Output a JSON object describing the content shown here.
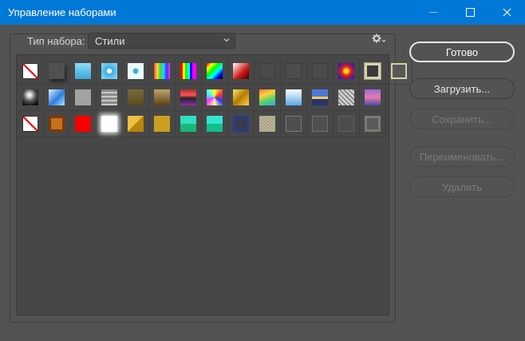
{
  "window": {
    "title": "Управление наборами"
  },
  "set_type": {
    "label": "Тип набора:",
    "value": "Стили"
  },
  "buttons": {
    "done": "Готово",
    "load": "Загрузить...",
    "save": "Сохранить...",
    "rename": "Переименовать...",
    "delete": "Удалить"
  },
  "icons": {
    "gear": "gear-icon",
    "dropdown": "chevron-down-icon",
    "minimize": "minimize-icon",
    "maximize": "maximize-icon",
    "close": "close-icon"
  },
  "colors": {
    "titlebar": "#0078d7",
    "panel": "#535353"
  },
  "styles_grid": {
    "rows": [
      [
        "none",
        "drop-shadow-gray",
        "blue-gradient",
        "blue-dot",
        "blue-dot-light",
        "rainbow-vertical",
        "rainbow-bars",
        "spectrum",
        "red-fade",
        "dark-square",
        "dark-square-2",
        "dark-square-3",
        "purple-orange",
        "yellow-radial",
        "beige-frame"
      ],
      [
        "chrome-ball",
        "blue-glass",
        "gray-flat",
        "metal-text",
        "olive-brown",
        "brown-gradient",
        "red-stripes",
        "noise-color",
        "gold-sheen",
        "rainbow-diagonal",
        "sky-gradient",
        "sunset-horizon",
        "engraved-frame",
        "purple-stripes"
      ],
      [
        "none",
        "copper-frame",
        "red-solid",
        "white-glow",
        "gold-envelope",
        "gold-flat",
        "teal-envelope",
        "teal-envelope-2",
        "navy-frame",
        "stone-texture",
        "outline-square",
        "outline-square-2",
        "outline-square-3",
        "inset-square"
      ]
    ]
  }
}
